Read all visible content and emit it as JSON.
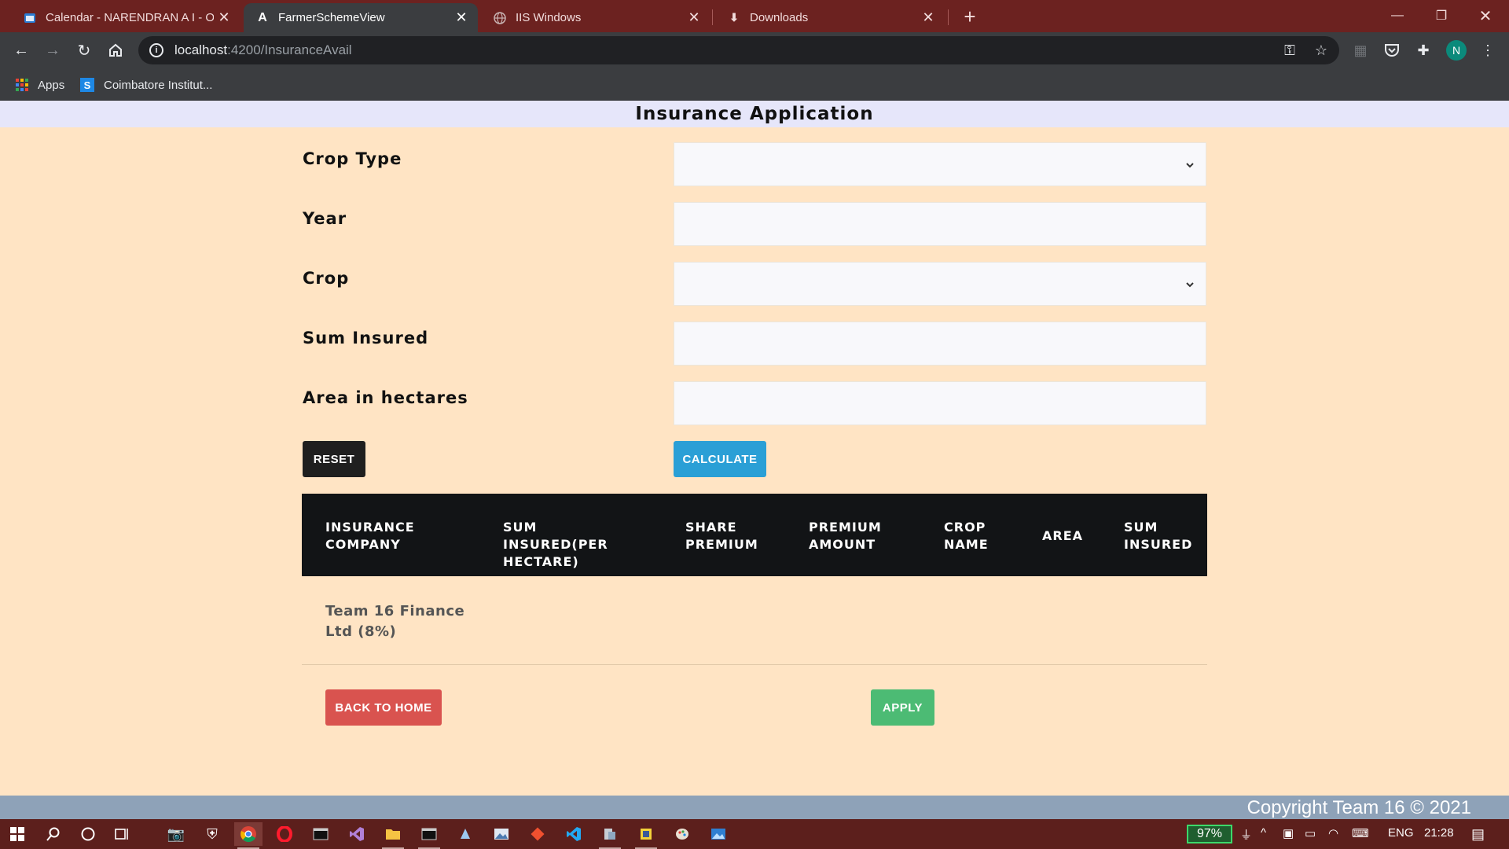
{
  "browser": {
    "tabs": [
      {
        "title": "Calendar - NARENDRAN A I - Ou",
        "icon": "outlook-calendar-icon",
        "active": false
      },
      {
        "title": "FarmerSchemeView",
        "icon": "angular-icon",
        "active": true
      },
      {
        "title": "IIS Windows",
        "icon": "globe-icon",
        "active": false
      },
      {
        "title": "Downloads",
        "icon": "download-icon",
        "active": false
      }
    ],
    "url_host": "localhost",
    "url_path": ":4200/InsuranceAvail",
    "profile_initial": "N",
    "bookmarks": [
      {
        "label": "Apps",
        "icon": "apps-grid-icon"
      },
      {
        "label": "Coimbatore Institut...",
        "icon": "s-favicon-icon"
      }
    ]
  },
  "page": {
    "title": "Insurance Application",
    "form": {
      "crop_type_label": "Crop Type",
      "year_label": "Year",
      "crop_label": "Crop",
      "sum_insured_label": "Sum Insured",
      "area_label": "Area in hectares",
      "crop_type_value": "",
      "year_value": "",
      "crop_value": "",
      "sum_insured_value": "",
      "area_value": ""
    },
    "buttons": {
      "reset": "RESET",
      "calculate": "CALCULATE",
      "back": "BACK TO HOME",
      "apply": "APPLY"
    },
    "table": {
      "headers": [
        "INSURANCE COMPANY",
        "SUM INSURED(PER HECTARE)",
        "SHARE PREMIUM",
        "PREMIUM AMOUNT",
        "CROP NAME",
        "AREA",
        "SUM INSURED"
      ],
      "rows": [
        {
          "company": "Team 16 Finance Ltd (8%)",
          "sum_insured_per_hectare": "",
          "share_premium": "",
          "premium_amount": "",
          "crop_name": "",
          "area": "",
          "sum_insured": ""
        }
      ]
    },
    "footer": "Copyright Team 16 © 2021"
  },
  "taskbar": {
    "battery": "97%",
    "language": "ENG",
    "time": "21:28"
  },
  "colors": {
    "page_bg": "#ffe4c4",
    "title_bg": "#e6e6fa",
    "table_header_bg": "#121416",
    "reset_btn": "#1f1f1f",
    "calculate_btn": "#2a9fd6",
    "back_btn": "#d9534f",
    "apply_btn": "#4cbb74",
    "footer_bg": "#8ea2b8",
    "tabbar_bg": "#6c2220"
  }
}
